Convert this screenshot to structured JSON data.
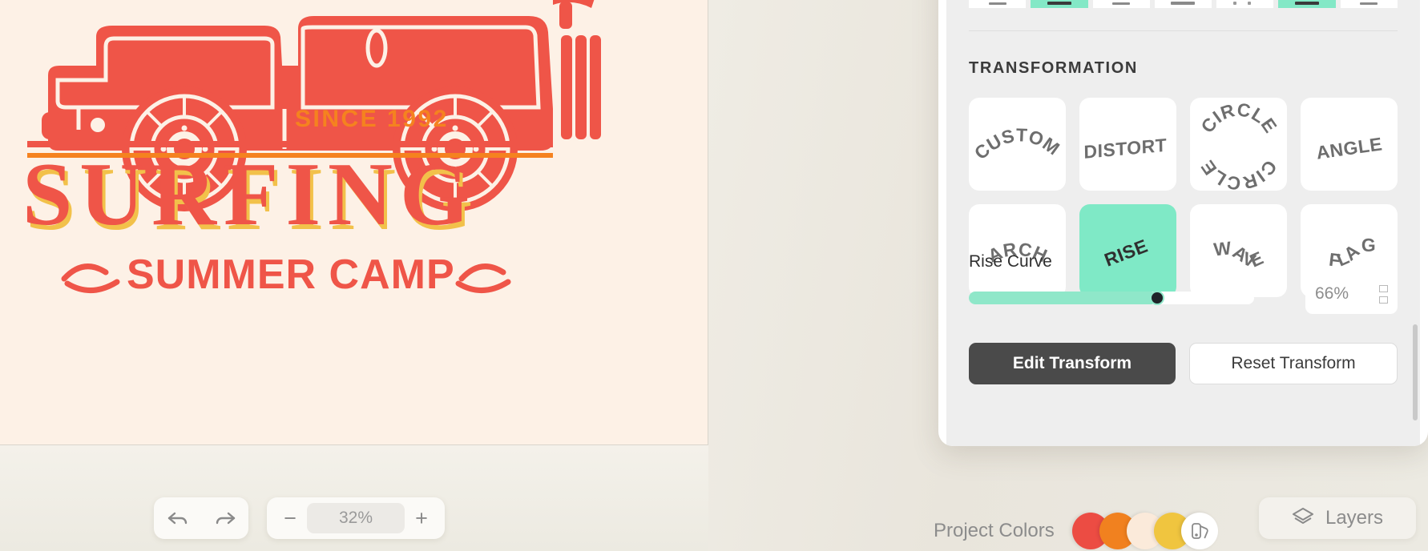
{
  "canvas": {
    "artwork": {
      "since_text": "SINCE 1992",
      "headline": "SURFING",
      "subline": "SUMMER CAMP",
      "colors": {
        "background": "#fdf1e6",
        "primary_red": "#ef5548",
        "orange": "#f5821f",
        "gold": "#f2c14a"
      }
    }
  },
  "inspector": {
    "align_strip": [
      {
        "name": "align-option-1",
        "active": false
      },
      {
        "name": "align-option-2",
        "active": true
      },
      {
        "name": "align-option-3",
        "active": false
      },
      {
        "name": "align-option-4",
        "active": false
      },
      {
        "name": "align-option-5",
        "active": false
      },
      {
        "name": "align-option-6",
        "active": true
      },
      {
        "name": "align-option-7",
        "active": false
      }
    ],
    "section_title": "TRANSFORMATION",
    "transformations": [
      {
        "label": "CUSTOM",
        "style": "arch",
        "active": false
      },
      {
        "label": "DISTORT",
        "style": "tilt",
        "active": false
      },
      {
        "label": "CIRCLE",
        "style": "circle",
        "active": false
      },
      {
        "label": "ANGLE",
        "style": "angle",
        "active": false
      },
      {
        "label": "ARCH",
        "style": "arch-small",
        "active": false
      },
      {
        "label": "RISE",
        "style": "rise",
        "active": true
      },
      {
        "label": "WAVE",
        "style": "wave",
        "active": false
      },
      {
        "label": "FLAG",
        "style": "flag",
        "active": false
      }
    ],
    "circle_label_top": "CIRCLE",
    "circle_label_bottom": "CIRCLE",
    "curve": {
      "label": "Rise Curve",
      "value": "66%",
      "percent": 66
    },
    "buttons": {
      "edit": "Edit Transform",
      "reset": "Reset Transform"
    },
    "accent_color": "#7fe9c6"
  },
  "bottom_bar": {
    "undo_icon": "undo-arrow-icon",
    "redo_icon": "redo-arrow-icon",
    "zoom_out": "−",
    "zoom_in": "+",
    "zoom_value": "32%",
    "project_colors_label": "Project Colors",
    "swatches": [
      "#ec4c43",
      "#f1811f",
      "#fbeada",
      "#f0c53f"
    ],
    "palette_icon": "palette-icon",
    "layers_label": "Layers",
    "layers_icon": "layers-icon"
  }
}
